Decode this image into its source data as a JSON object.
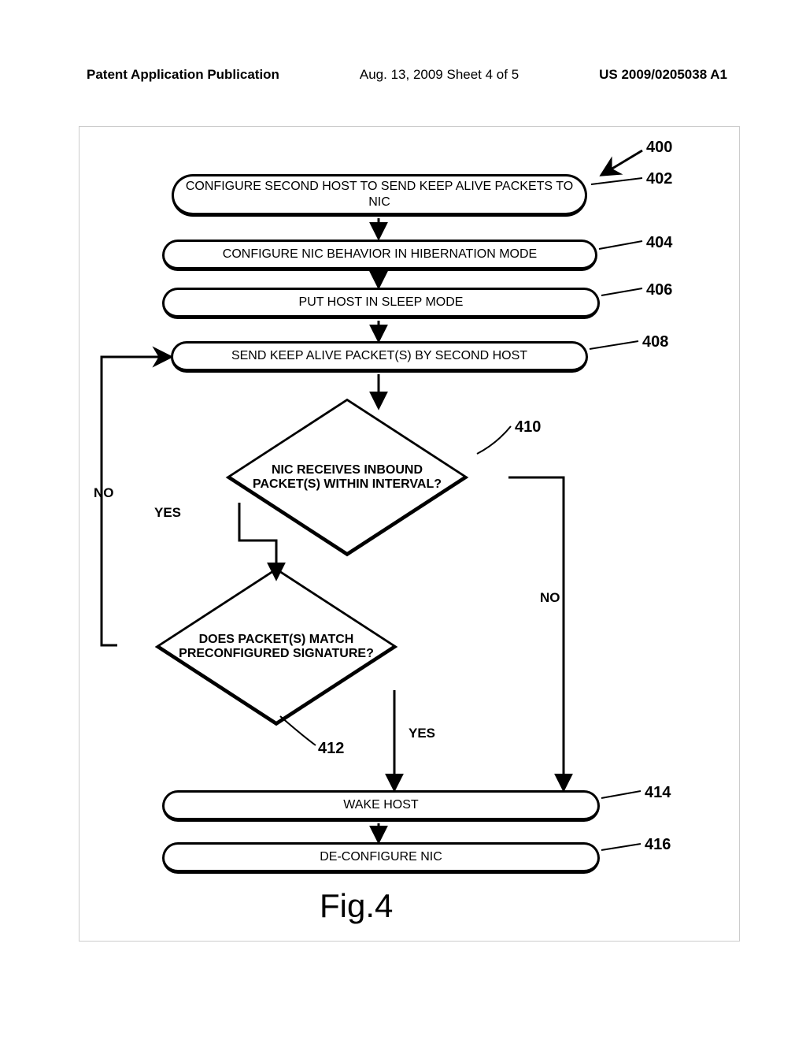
{
  "header": {
    "left": "Patent Application Publication",
    "center": "Aug. 13, 2009  Sheet 4 of 5",
    "right": "US 2009/0205038 A1"
  },
  "refs": {
    "r400": "400",
    "r402": "402",
    "r404": "404",
    "r406": "406",
    "r408": "408",
    "r410": "410",
    "r412": "412",
    "r414": "414",
    "r416": "416"
  },
  "nodes": {
    "n402": "CONFIGURE SECOND HOST TO SEND KEEP ALIVE PACKETS TO NIC",
    "n404": "CONFIGURE NIC BEHAVIOR IN HIBERNATION MODE",
    "n406": "PUT HOST IN SLEEP MODE",
    "n408": "SEND KEEP ALIVE PACKET(S) BY SECOND HOST",
    "n410": "NIC RECEIVES INBOUND PACKET(S) WITHIN INTERVAL?",
    "n412": "DOES PACKET(S) MATCH PRECONFIGURED SIGNATURE?",
    "n414": "WAKE HOST",
    "n416": "DE-CONFIGURE NIC"
  },
  "edges": {
    "yes410": "YES",
    "no410": "NO",
    "yes412": "YES",
    "no412": "NO"
  },
  "figure": "Fig.4"
}
